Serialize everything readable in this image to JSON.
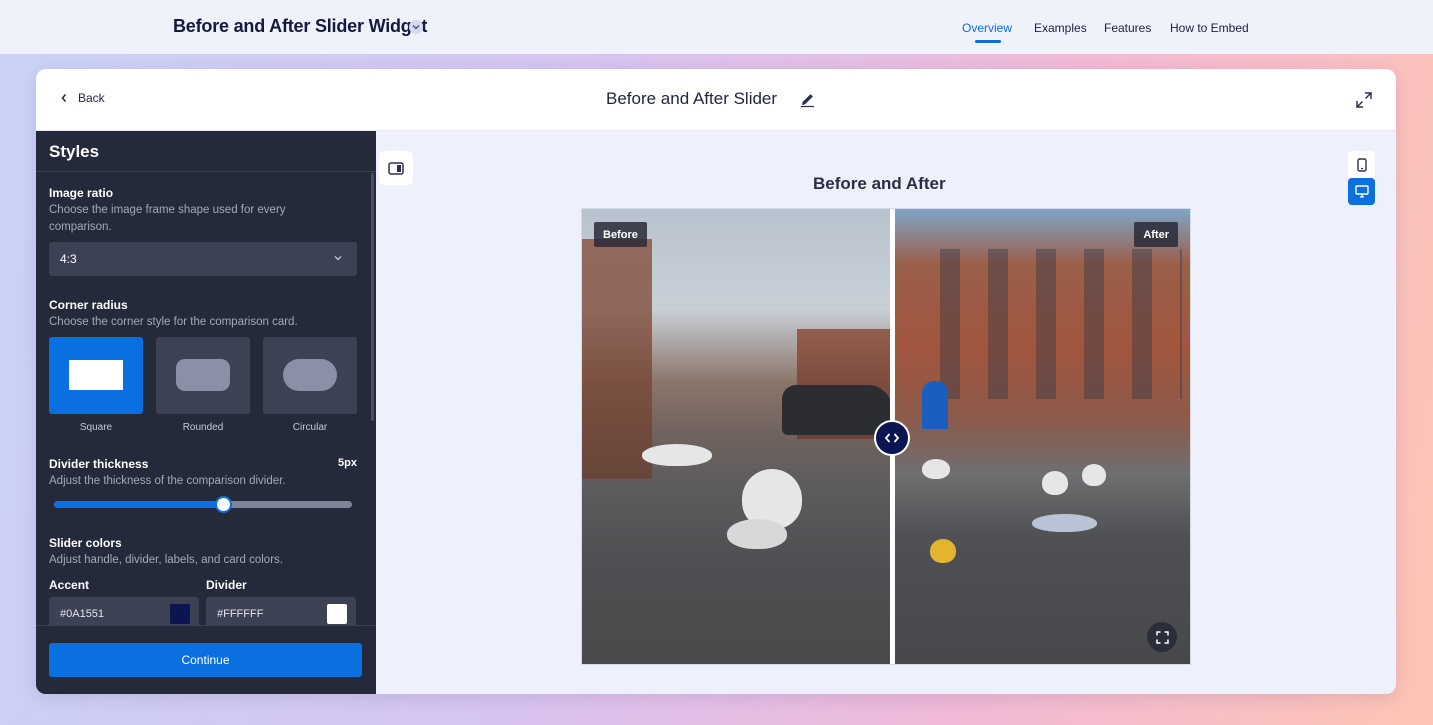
{
  "app": {
    "title": "Before and After Slider Widget"
  },
  "nav": {
    "items": [
      {
        "label": "Overview",
        "active": true
      },
      {
        "label": "Examples",
        "active": false
      },
      {
        "label": "Features",
        "active": false
      },
      {
        "label": "How to Embed",
        "active": false
      }
    ]
  },
  "editor": {
    "back_label": "Back",
    "title": "Before and After Slider"
  },
  "sidebar": {
    "heading": "Styles",
    "image_ratio": {
      "label": "Image ratio",
      "description": "Choose the image frame shape used for every comparison.",
      "value": "4:3"
    },
    "corner_radius": {
      "label": "Corner radius",
      "description": "Choose the corner style for the comparison card.",
      "options": [
        {
          "label": "Square",
          "selected": true
        },
        {
          "label": "Rounded",
          "selected": false
        },
        {
          "label": "Circular",
          "selected": false
        }
      ]
    },
    "divider_thickness": {
      "label": "Divider thickness",
      "value": "5px",
      "description": "Adjust the thickness of the comparison divider.",
      "slider_fraction": 0.57
    },
    "slider_colors": {
      "label": "Slider colors",
      "description": "Adjust handle, divider, labels, and card colors.",
      "accent_label": "Accent",
      "accent_value": "#0A1551",
      "divider_label": "Divider",
      "divider_value": "#FFFFFF"
    },
    "continue_label": "Continue"
  },
  "preview": {
    "widget_title": "Before and After",
    "before_label": "Before",
    "after_label": "After",
    "divider_position_fraction": 0.51
  },
  "colors": {
    "primary": "#0a6fe0",
    "sidebar_bg": "#252a3b",
    "accent": "#0A1551"
  }
}
